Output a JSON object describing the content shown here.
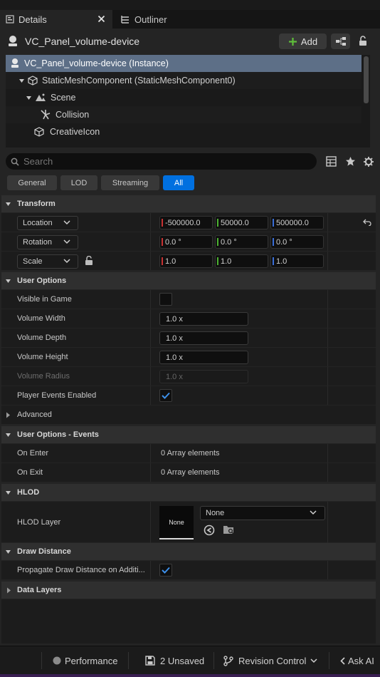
{
  "tabs": [
    {
      "label": "Details",
      "active": true
    },
    {
      "label": "Outliner",
      "active": false
    }
  ],
  "actor": {
    "name": "VC_Panel_volume-device",
    "add_label": "Add"
  },
  "tree": [
    {
      "label": "VC_Panel_volume-device (Instance)",
      "selected": true
    },
    {
      "label": "StaticMeshComponent (StaticMeshComponent0)"
    },
    {
      "label": "Scene"
    },
    {
      "label": "Collision"
    },
    {
      "label": "CreativeIcon"
    }
  ],
  "search": {
    "placeholder": "Search"
  },
  "filters": [
    {
      "label": "General",
      "active": false
    },
    {
      "label": "LOD",
      "active": false
    },
    {
      "label": "Streaming",
      "active": false
    },
    {
      "label": "All",
      "active": true
    }
  ],
  "transform": {
    "title": "Transform",
    "location": {
      "label": "Location",
      "x": "-500000.0",
      "y": "50000.0",
      "z": "500000.0"
    },
    "rotation": {
      "label": "Rotation",
      "x": "0.0 °",
      "y": "0.0 °",
      "z": "0.0 °"
    },
    "scale": {
      "label": "Scale",
      "x": "1.0",
      "y": "1.0",
      "z": "1.0"
    }
  },
  "user_options": {
    "title": "User Options",
    "visible_in_game": {
      "label": "Visible in Game",
      "checked": false
    },
    "volume_width": {
      "label": "Volume Width",
      "value": "1.0 x"
    },
    "volume_depth": {
      "label": "Volume Depth",
      "value": "1.0 x"
    },
    "volume_height": {
      "label": "Volume Height",
      "value": "1.0 x"
    },
    "volume_radius": {
      "label": "Volume Radius",
      "value": "1.0 x"
    },
    "player_events": {
      "label": "Player Events Enabled",
      "checked": true
    }
  },
  "advanced": {
    "label": "Advanced"
  },
  "events": {
    "title": "User Options - Events",
    "on_enter": {
      "label": "On Enter",
      "value": "0 Array elements"
    },
    "on_exit": {
      "label": "On Exit",
      "value": "0 Array elements"
    }
  },
  "hlod": {
    "title": "HLOD",
    "layer_label": "HLOD Layer",
    "thumb": "None",
    "selected": "None"
  },
  "draw_distance": {
    "title": "Draw Distance",
    "propagate": {
      "label": "Propagate Draw Distance on Additi...",
      "checked": true
    }
  },
  "data_layers": {
    "title": "Data Layers"
  },
  "statusbar": {
    "performance": "Performance",
    "unsaved": "2 Unsaved",
    "revision": "Revision Control",
    "ask_ai": "Ask AI"
  },
  "colors": {
    "accent": "#0070e0",
    "selection": "#5d6f87",
    "axis_x": "#c83232",
    "axis_y": "#4cb030",
    "axis_z": "#3a6fd8",
    "add_icon": "#5fbf3a"
  }
}
